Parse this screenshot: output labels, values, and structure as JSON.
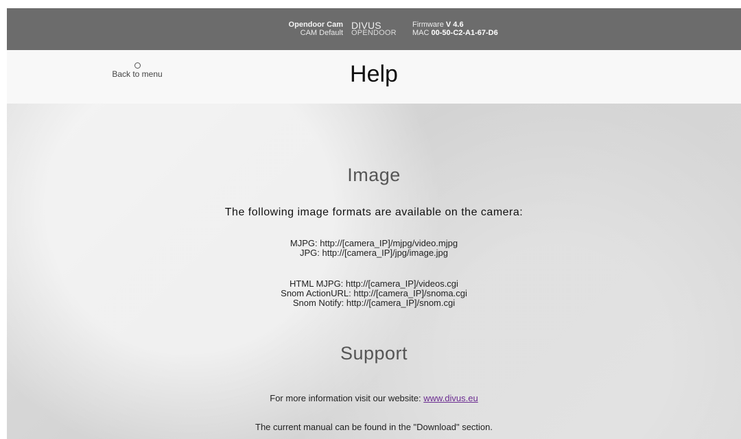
{
  "header": {
    "camera_name": "Opendoor Cam",
    "camera_profile": "CAM Default",
    "logo_top": "DIVUS",
    "logo_bottom": "OPENDOOR",
    "firmware_label": "Firmware",
    "firmware_value": "V 4.6",
    "mac_label": "MAC",
    "mac_value": "00-50-C2-A1-67-D6"
  },
  "title_bar": {
    "back_label": "Back to menu",
    "page_title": "Help"
  },
  "sections": {
    "image": {
      "heading": "Image",
      "intro": "The following image formats are available on the camera:",
      "formats_group_1": [
        "MJPG: http://[camera_IP]/mjpg/video.mjpg",
        "JPG: http://[camera_IP]/jpg/image.jpg"
      ],
      "formats_group_2": [
        "HTML MJPG: http://[camera_IP]/videos.cgi",
        "Snom ActionURL: http://[camera_IP]/snoma.cgi",
        "Snom Notify: http://[camera_IP]/snom.cgi"
      ]
    },
    "support": {
      "heading": "Support",
      "website_text": "For more information visit our website:",
      "website_link": "www.divus.eu",
      "manual_text": "The current manual can be found in the \"Download\" section."
    }
  },
  "colors": {
    "header_background": "#6c6c6c",
    "title_bar_background": "#f8f8f8",
    "content_background": "#d8d8d8",
    "link_color": "#6b2c91"
  },
  "icons": {
    "back": "circle-icon"
  }
}
